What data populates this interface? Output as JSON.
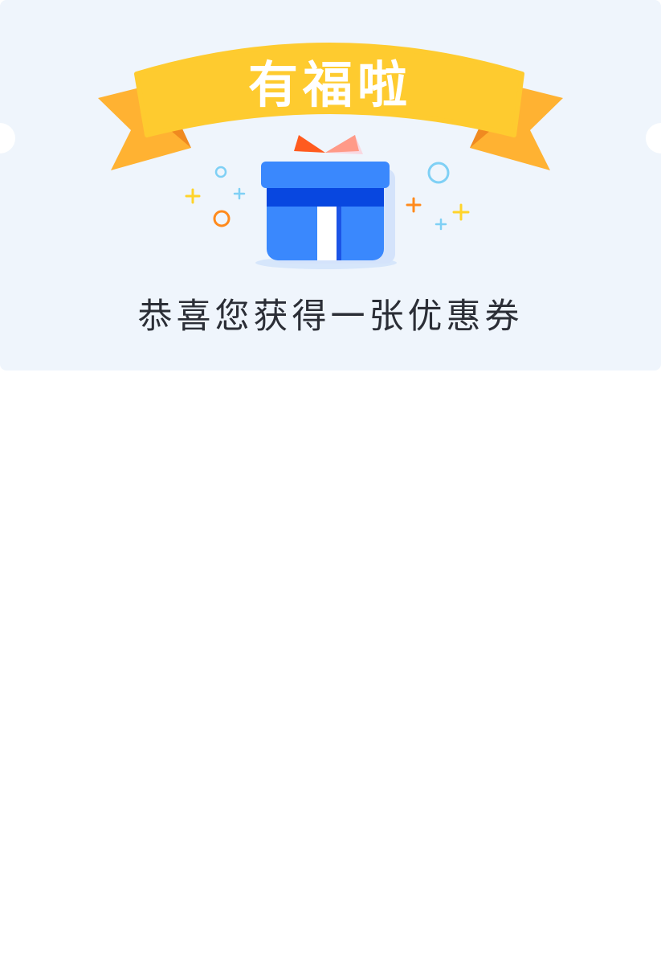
{
  "coupon": {
    "banner_title": "有福啦",
    "message": "恭喜您获得一张优惠券"
  },
  "colors": {
    "card_background": "#eff5fc",
    "ribbon": "#fecb2f",
    "ribbon_tail": "#ffb232",
    "gift_box": "#3a88fd",
    "gift_band": "#0847e0",
    "bow": "#ff5b1f",
    "text": "#2b2e36"
  }
}
